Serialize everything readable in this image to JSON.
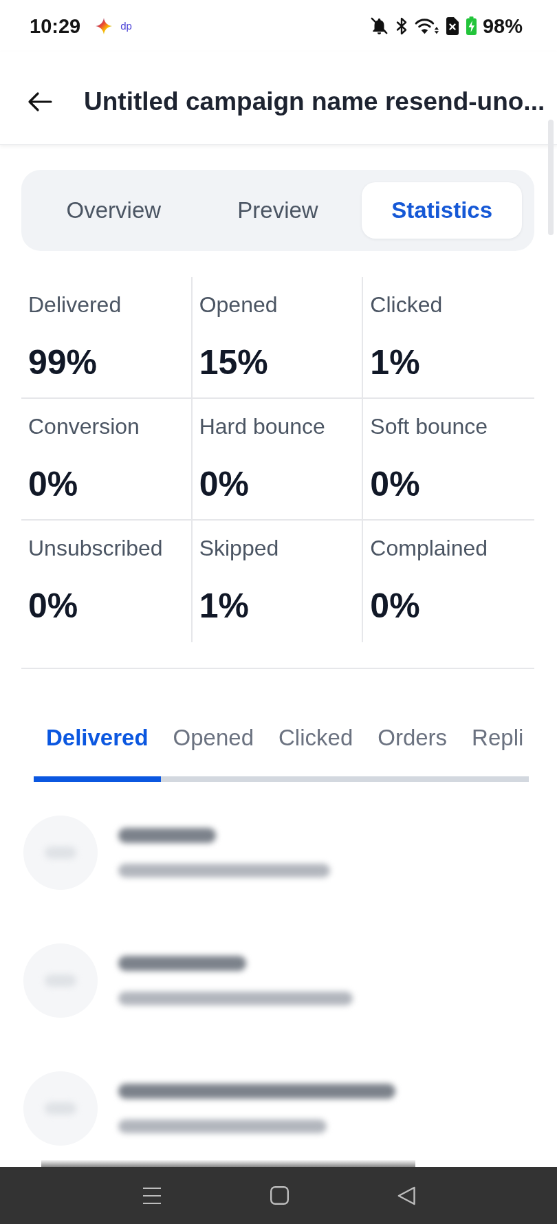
{
  "status_bar": {
    "time": "10:29",
    "app_badge": "dp",
    "battery": "98%",
    "charging": true
  },
  "header": {
    "title": "Untitled campaign name resend-uno..."
  },
  "view_tabs": [
    {
      "label": "Overview",
      "selected": false
    },
    {
      "label": "Preview",
      "selected": false
    },
    {
      "label": "Statistics",
      "selected": true
    }
  ],
  "stats": [
    {
      "label": "Delivered",
      "value": "99%"
    },
    {
      "label": "Opened",
      "value": "15%"
    },
    {
      "label": "Clicked",
      "value": "1%"
    },
    {
      "label": "Conversion",
      "value": "0%"
    },
    {
      "label": "Hard bounce",
      "value": "0%"
    },
    {
      "label": "Soft bounce",
      "value": "0%"
    },
    {
      "label": "Unsubscribed",
      "value": "0%"
    },
    {
      "label": "Skipped",
      "value": "1%"
    },
    {
      "label": "Complained",
      "value": "0%"
    }
  ],
  "list_tabs": [
    {
      "label": "Delivered",
      "selected": true
    },
    {
      "label": "Opened",
      "selected": false
    },
    {
      "label": "Clicked",
      "selected": false
    },
    {
      "label": "Orders",
      "selected": false
    },
    {
      "label": "Repli",
      "selected": false
    }
  ],
  "recipients": [
    {
      "kind": "blurred"
    },
    {
      "kind": "blurred"
    },
    {
      "kind": "blurred"
    }
  ]
}
